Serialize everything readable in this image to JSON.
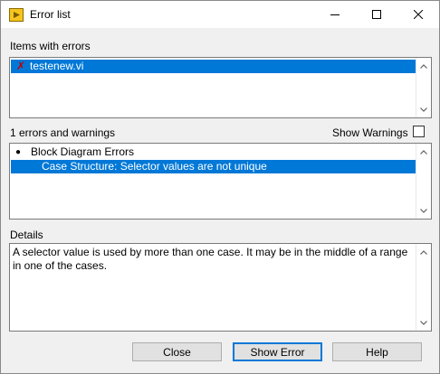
{
  "window": {
    "title": "Error list",
    "minimize_icon": "minimize-icon",
    "maximize_icon": "maximize-icon",
    "close_icon": "close-icon"
  },
  "items_section": {
    "label": "Items with errors",
    "items": [
      {
        "name": "testenew.vi",
        "icon": "error-x-icon",
        "selected": true
      }
    ]
  },
  "errors_section": {
    "count_label": "1 errors and warnings",
    "show_warnings_label": "Show Warnings",
    "show_warnings_checked": false,
    "tree": [
      {
        "label": "Block Diagram Errors",
        "bullet": "●",
        "selected": false
      },
      {
        "label": "Case Structure: Selector values are not unique",
        "selected": true
      }
    ]
  },
  "details_section": {
    "label": "Details",
    "line1": "A selector value is used by more than one case.  It may be in the middle of a range",
    "line2": "in one of the cases."
  },
  "buttons": {
    "close": "Close",
    "show_error": "Show Error",
    "help": "Help"
  },
  "colors": {
    "selection": "#0078d7",
    "error_x": "#c00000"
  }
}
